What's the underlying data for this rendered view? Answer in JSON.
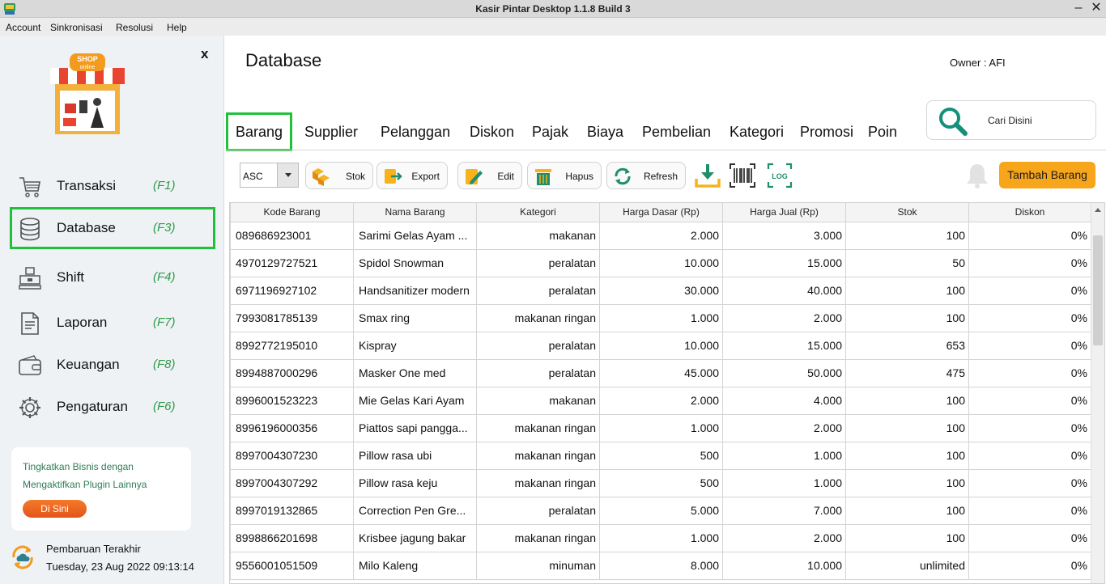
{
  "window": {
    "title": "Kasir Pintar Desktop 1.1.8  Build 3",
    "minimize": "–",
    "close": "✕"
  },
  "menu": [
    "Account",
    "Sinkronisasi",
    "Resolusi",
    "Help"
  ],
  "sidebar": {
    "close": "x",
    "logo_text": [
      "SHOP",
      "online"
    ],
    "items": [
      {
        "label": "Transaksi",
        "key": "(F1)",
        "icon": "cart-icon"
      },
      {
        "label": "Database",
        "key": "(F3)",
        "icon": "database-icon"
      },
      {
        "label": "Shift",
        "key": "(F4)",
        "icon": "register-icon"
      },
      {
        "label": "Laporan",
        "key": "(F7)",
        "icon": "report-icon"
      },
      {
        "label": "Keuangan",
        "key": "(F8)",
        "icon": "wallet-icon"
      },
      {
        "label": "Pengaturan",
        "key": "(F6)",
        "icon": "gear-icon"
      }
    ],
    "active_item": "Database",
    "promo": {
      "line1": "Tingkatkan Bisnis dengan",
      "line2": "Mengaktifkan Plugin Lainnya",
      "button": "Di Sini"
    },
    "update": {
      "label": "Pembaruan Terakhir",
      "time": "Tuesday, 23 Aug 2022 09:13:14"
    }
  },
  "header": {
    "title": "Database",
    "owner": "Owner : AFI"
  },
  "tabs": [
    "Barang",
    "Supplier",
    "Pelanggan",
    "Diskon",
    "Pajak",
    "Biaya",
    "Pembelian",
    "Kategori",
    "Promosi",
    "Poin"
  ],
  "active_tab": "Barang",
  "search": {
    "label": "Cari Disini"
  },
  "toolbar": {
    "sort_value": "ASC",
    "buttons": [
      "Stok",
      "Export",
      "Edit",
      "Hapus",
      "Refresh"
    ],
    "icons": [
      "download-icon",
      "barcode-icon",
      "log-icon"
    ],
    "log_text": "LOG",
    "add_button": "Tambah Barang"
  },
  "colors": {
    "accent_green": "#22c03a",
    "primary_orange": "#f7a61c",
    "promo_button": "#e96a22",
    "key_green": "#2f9a4a"
  },
  "table": {
    "columns": [
      "Kode Barang",
      "Nama Barang",
      "Kategori",
      "Harga Dasar (Rp)",
      "Harga Jual (Rp)",
      "Stok",
      "Diskon"
    ],
    "rows": [
      [
        "089686923001",
        "Sarimi Gelas Ayam ...",
        "makanan",
        "2.000",
        "3.000",
        "100",
        "0%"
      ],
      [
        "4970129727521",
        "Spidol Snowman",
        "peralatan",
        "10.000",
        "15.000",
        "50",
        "0%"
      ],
      [
        "6971196927102",
        "Handsanitizer modern",
        "peralatan",
        "30.000",
        "40.000",
        "100",
        "0%"
      ],
      [
        "7993081785139",
        "Smax ring",
        "makanan ringan",
        "1.000",
        "2.000",
        "100",
        "0%"
      ],
      [
        "8992772195010",
        "Kispray",
        "peralatan",
        "10.000",
        "15.000",
        "653",
        "0%"
      ],
      [
        "8994887000296",
        "Masker One med",
        "peralatan",
        "45.000",
        "50.000",
        "475",
        "0%"
      ],
      [
        "8996001523223",
        "Mie Gelas Kari Ayam",
        "makanan",
        "2.000",
        "4.000",
        "100",
        "0%"
      ],
      [
        "8996196000356",
        "Piattos sapi pangga...",
        "makanan ringan",
        "1.000",
        "2.000",
        "100",
        "0%"
      ],
      [
        "8997004307230",
        "Pillow rasa ubi",
        "makanan ringan",
        "500",
        "1.000",
        "100",
        "0%"
      ],
      [
        "8997004307292",
        "Pillow rasa keju",
        "makanan ringan",
        "500",
        "1.000",
        "100",
        "0%"
      ],
      [
        "8997019132865",
        "Correction Pen Gre...",
        "peralatan",
        "5.000",
        "7.000",
        "100",
        "0%"
      ],
      [
        "8998866201698",
        "Krisbee jagung bakar",
        "makanan ringan",
        "1.000",
        "2.000",
        "100",
        "0%"
      ],
      [
        "9556001051509",
        "Milo Kaleng",
        "minuman",
        "8.000",
        "10.000",
        "unlimited",
        "0%"
      ]
    ]
  }
}
